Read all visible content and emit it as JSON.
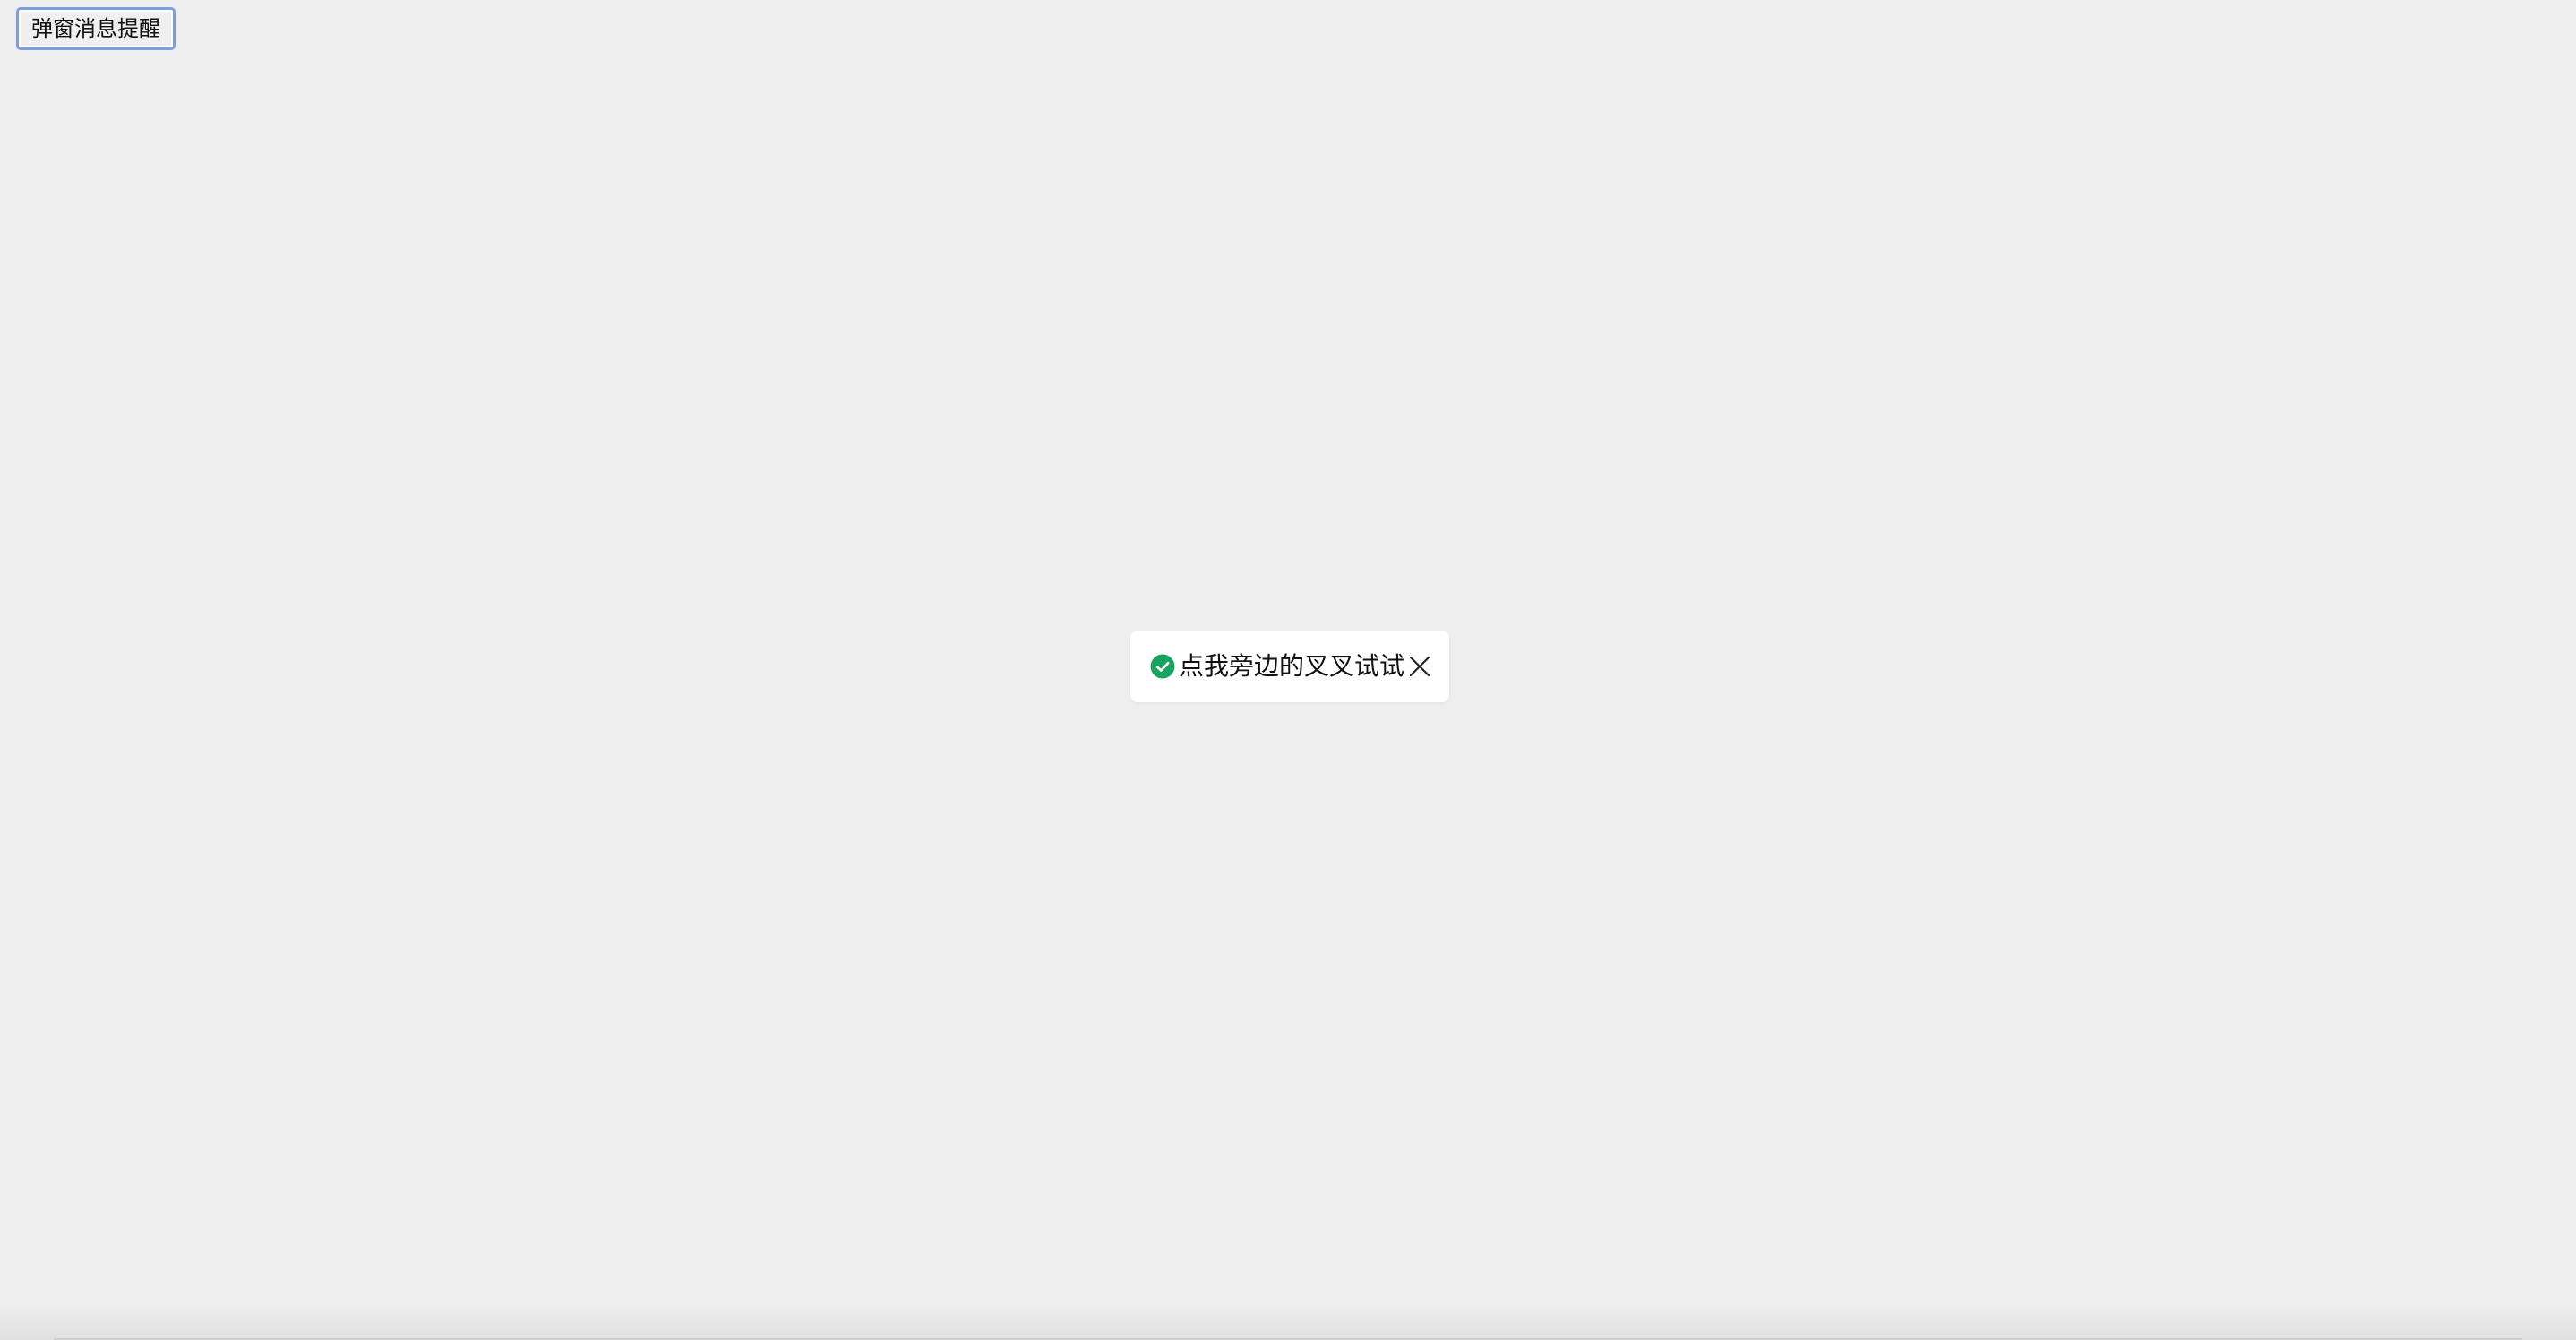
{
  "trigger": {
    "label": "弹窗消息提醒"
  },
  "toast": {
    "message": "点我旁边的叉叉试试",
    "status_icon": "success-check-icon",
    "close_icon": "close-icon",
    "status_color": "#1aa260"
  }
}
